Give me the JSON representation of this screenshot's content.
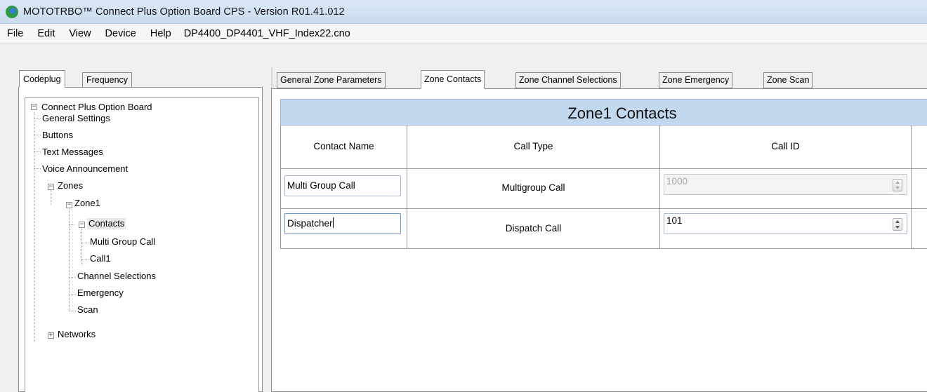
{
  "window": {
    "title": "MOTOTRBO™ Connect Plus Option Board CPS - Version R01.41.012"
  },
  "menu": {
    "items": [
      "File",
      "Edit",
      "View",
      "Device",
      "Help"
    ],
    "filename": "DP4400_DP4401_VHF_Index22.cno"
  },
  "left_tabs": {
    "codeplug": "Codeplug",
    "frequency": "Frequency"
  },
  "tree": {
    "root": "Connect Plus Option Board",
    "general_settings": "General Settings",
    "buttons": "Buttons",
    "text_messages": "Text Messages",
    "voice_announcement": "Voice Announcement",
    "zones": "Zones",
    "zone1": "Zone1",
    "contacts": "Contacts",
    "multi_group_call": "Multi Group Call",
    "call1": "Call1",
    "channel_selections": "Channel Selections",
    "emergency": "Emergency",
    "scan": "Scan",
    "networks": "Networks"
  },
  "tabs": {
    "general": "General Zone Parameters",
    "contacts": "Zone Contacts",
    "channel": "Zone Channel Selections",
    "emergency": "Zone Emergency",
    "scan": "Zone Scan"
  },
  "table": {
    "heading": "Zone1 Contacts",
    "col_contact_name": "Contact Name",
    "col_call_type": "Call Type",
    "col_call_id": "Call ID",
    "rows": [
      {
        "name": "Multi Group Call",
        "type": "Multigroup Call",
        "id": "1000"
      },
      {
        "name": "Dispatcher",
        "type": "Dispatch Call",
        "id": "101"
      }
    ]
  }
}
